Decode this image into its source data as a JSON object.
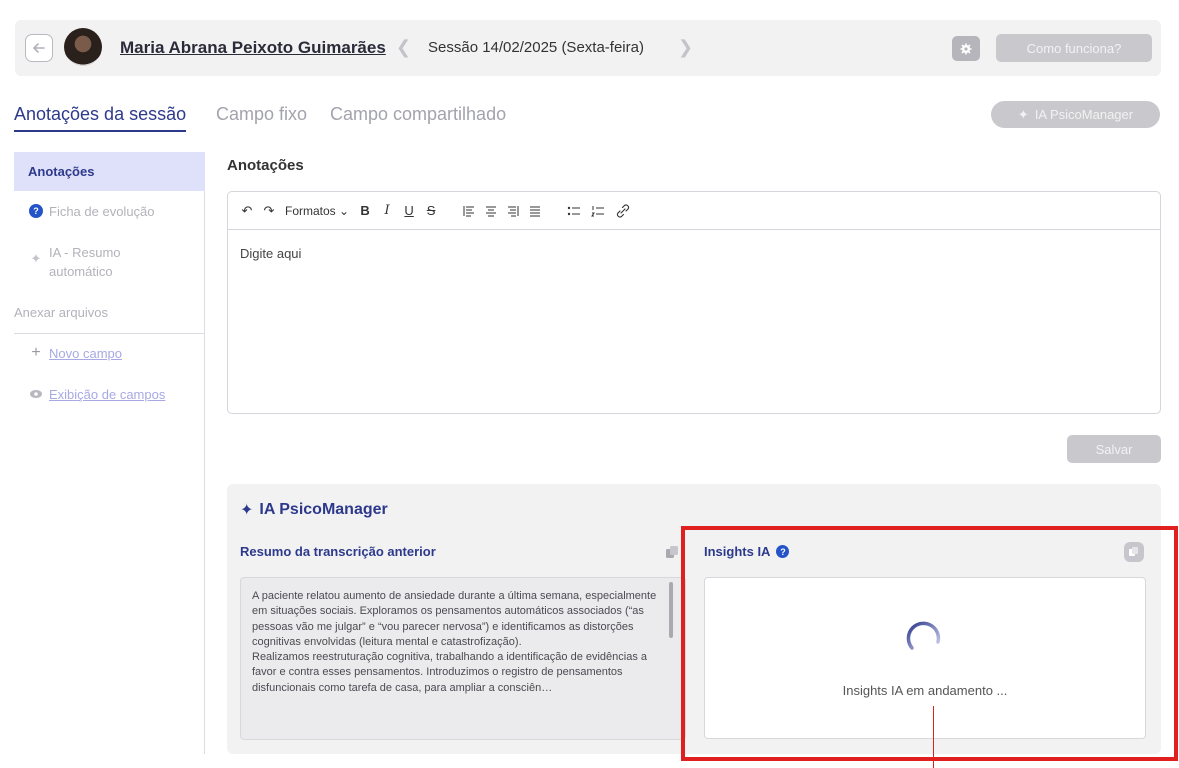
{
  "header": {
    "patient_name": "Maria Abrana Peixoto Guimarães",
    "session_label": "Sessão 14/02/2025 (Sexta-feira)",
    "how_it_works_label": "Como funciona?"
  },
  "tabs": [
    {
      "label": "Anotações da sessão",
      "active": true
    },
    {
      "label": "Campo fixo",
      "active": false
    },
    {
      "label": "Campo compartilhado",
      "active": false
    }
  ],
  "ia_button_label": "IA PsicoManager",
  "sidebar": {
    "items": [
      {
        "label": "Anotações"
      },
      {
        "label": "Ficha de evolução"
      },
      {
        "label": "IA - Resumo automático"
      },
      {
        "label": "Anexar arquivos"
      },
      {
        "label": "Novo campo"
      },
      {
        "label": "Exibição de campos"
      }
    ]
  },
  "editor": {
    "section_title": "Anotações",
    "formats_label": "Formatos",
    "placeholder": "Digite aqui",
    "save_label": "Salvar"
  },
  "ia_panel": {
    "title": "IA PsicoManager",
    "resume_title": "Resumo da transcrição anterior",
    "resume_paragraph_1": "A paciente relatou aumento de ansiedade durante a última semana, especialmente em situações sociais. Exploramos os pensamentos automáticos associados (“as pessoas vão me julgar” e “vou parecer nervosa”) e identificamos as distorções cognitivas envolvidas (leitura mental e catastrofização).",
    "resume_paragraph_2": "Realizamos reestruturação cognitiva, trabalhando a identificação de evidências a favor e contra esses pensamentos. Introduzimos o registro de pensamentos disfuncionais como tarefa de casa, para ampliar a consciên…",
    "insights_title": "Insights IA",
    "insights_status": "Insights IA em andamento ..."
  },
  "colors": {
    "accent": "#2d3a8c",
    "highlight": "#e01f1f",
    "disabled_button": "#c9c9cd"
  }
}
